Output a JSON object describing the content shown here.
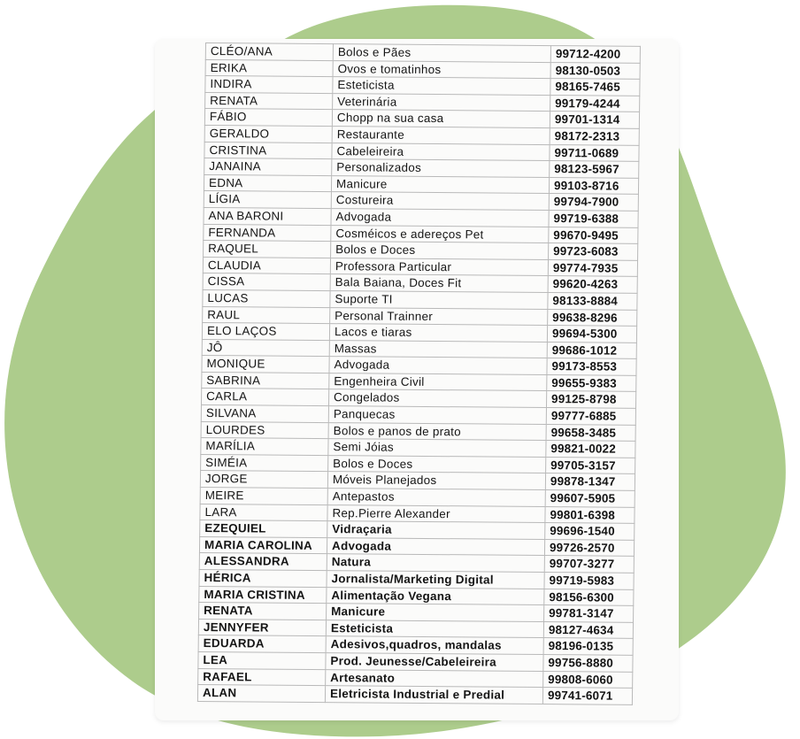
{
  "colors": {
    "background": "#ffffff",
    "blob": "#adcc8c",
    "paper": "#fbfbfa",
    "text": "#141414",
    "grid": "#b9b9b9"
  },
  "contacts": [
    {
      "name": "CLÉO/ANA",
      "service": "Bolos e Pães",
      "phone": "99712-4200"
    },
    {
      "name": "ERIKA",
      "service": "Ovos e tomatinhos",
      "phone": "98130-0503"
    },
    {
      "name": "INDIRA",
      "service": "Esteticista",
      "phone": "98165-7465"
    },
    {
      "name": "RENATA",
      "service": "Veterinária",
      "phone": "99179-4244"
    },
    {
      "name": "FÁBIO",
      "service": "Chopp na sua casa",
      "phone": "99701-1314"
    },
    {
      "name": "GERALDO",
      "service": "Restaurante",
      "phone": "98172-2313"
    },
    {
      "name": "CRISTINA",
      "service": "Cabeleireira",
      "phone": "99711-0689"
    },
    {
      "name": "JANAINA",
      "service": "Personalizados",
      "phone": "98123-5967"
    },
    {
      "name": "EDNA",
      "service": "Manicure",
      "phone": "99103-8716"
    },
    {
      "name": "LÍGIA",
      "service": "Costureira",
      "phone": "99794-7900"
    },
    {
      "name": "ANA BARONI",
      "service": "Advogada",
      "phone": "99719-6388"
    },
    {
      "name": "FERNANDA",
      "service": "Cosméicos e adereços Pet",
      "phone": "99670-9495"
    },
    {
      "name": "RAQUEL",
      "service": "Bolos e Doces",
      "phone": "99723-6083"
    },
    {
      "name": "CLAUDIA",
      "service": "Professora Particular",
      "phone": "99774-7935"
    },
    {
      "name": "CISSA",
      "service": "Bala Baiana, Doces Fit",
      "phone": "99620-4263"
    },
    {
      "name": "LUCAS",
      "service": "Suporte TI",
      "phone": "98133-8884"
    },
    {
      "name": "RAUL",
      "service": "Personal Trainner",
      "phone": "99638-8296"
    },
    {
      "name": "ELO LAÇOS",
      "service": "Lacos e tiaras",
      "phone": "99694-5300"
    },
    {
      "name": "JÔ",
      "service": "Massas",
      "phone": "99686-1012"
    },
    {
      "name": "MONIQUE",
      "service": "Advogada",
      "phone": "99173-8553"
    },
    {
      "name": "SABRINA",
      "service": "Engenheira Civil",
      "phone": "99655-9383"
    },
    {
      "name": "CARLA",
      "service": "Congelados",
      "phone": "99125-8798"
    },
    {
      "name": "SILVANA",
      "service": "Panquecas",
      "phone": "99777-6885"
    },
    {
      "name": "LOURDES",
      "service": "Bolos e panos de prato",
      "phone": "99658-3485"
    },
    {
      "name": "MARÍLIA",
      "service": "Semi Jóias",
      "phone": "99821-0022"
    },
    {
      "name": "SIMÉIA",
      "service": "Bolos e Doces",
      "phone": "99705-3157"
    },
    {
      "name": "JORGE",
      "service": "Móveis Planejados",
      "phone": "99878-1347"
    },
    {
      "name": "MEIRE",
      "service": "Antepastos",
      "phone": "99607-5905"
    },
    {
      "name": "LARA",
      "service": "Rep.Pierre Alexander",
      "phone": "99801-6398"
    },
    {
      "name": "EZEQUIEL",
      "service": "Vidraçaria",
      "phone": "99696-1540"
    },
    {
      "name": "MARIA CAROLINA",
      "service": "Advogada",
      "phone": "99726-2570"
    },
    {
      "name": "ALESSANDRA",
      "service": "Natura",
      "phone": "99707-3277"
    },
    {
      "name": "HÉRICA",
      "service": "Jornalista/Marketing Digital",
      "phone": "99719-5983"
    },
    {
      "name": "MARIA CRISTINA",
      "service": "Alimentação Vegana",
      "phone": "98156-6300"
    },
    {
      "name": "RENATA",
      "service": "Manicure",
      "phone": "99781-3147"
    },
    {
      "name": "JENNYFER",
      "service": "Esteticista",
      "phone": "98127-4634"
    },
    {
      "name": "EDUARDA",
      "service": "Adesivos,quadros, mandalas",
      "phone": "98196-0135"
    },
    {
      "name": "LEA",
      "service": "Prod. Jeunesse/Cabeleireira",
      "phone": "99756-8880"
    },
    {
      "name": "RAFAEL",
      "service": "Artesanato",
      "phone": "99808-6060"
    },
    {
      "name": "ALAN",
      "service": "Eletricista Industrial e Predial",
      "phone": "99741-6071"
    }
  ],
  "bold_from_index": 29
}
